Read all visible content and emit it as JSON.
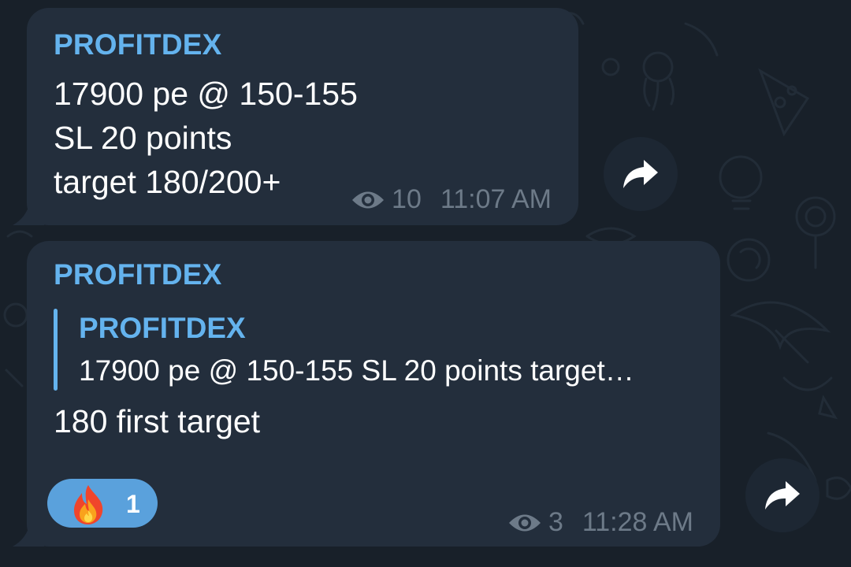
{
  "messages": [
    {
      "sender": "PROFITDEX",
      "lines": [
        "17900 pe @ 150-155",
        "SL 20 points",
        "target 180/200+"
      ],
      "views": "10",
      "time": "11:07 AM"
    },
    {
      "sender": "PROFITDEX",
      "reply": {
        "sender": "PROFITDEX",
        "text": "17900 pe @ 150-155 SL 20 points  target…"
      },
      "lines": [
        "180 first target"
      ],
      "reaction": {
        "emoji": "fire-icon",
        "count": "1"
      },
      "views": "3",
      "time": "11:28 AM"
    }
  ],
  "colors": {
    "background": "#182029",
    "bubble": "#232e3c",
    "accent": "#64b3ee",
    "reaction": "#5aa1dc",
    "meta": "#6d7a88"
  }
}
